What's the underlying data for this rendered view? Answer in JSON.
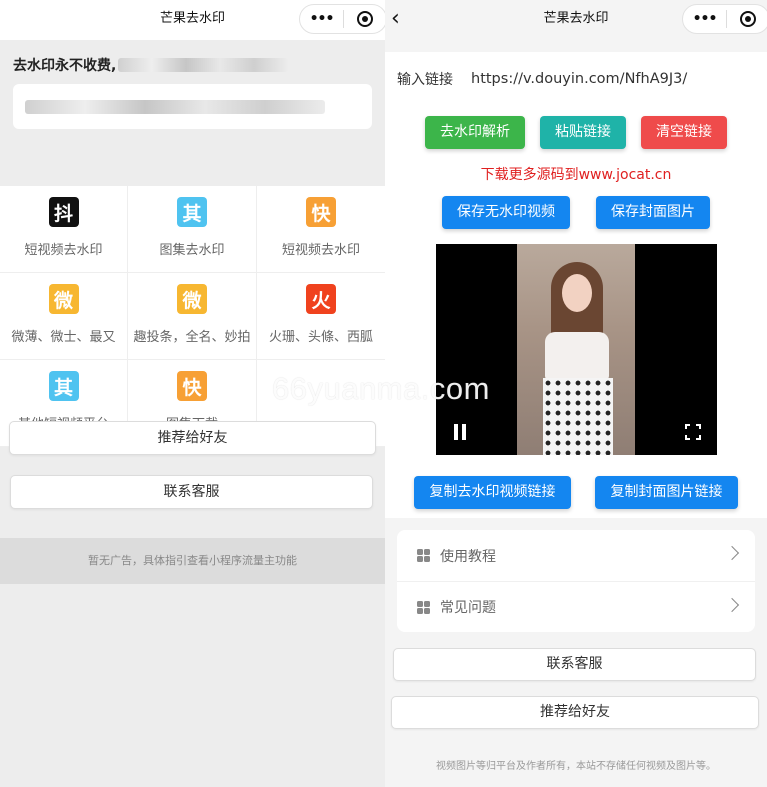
{
  "left": {
    "title": "芒果去水印",
    "menu_dots": "•••",
    "notice_title": "去水印永不收费,",
    "grid": [
      {
        "glyph": "抖",
        "label": "短视频去水印",
        "color": "#111111"
      },
      {
        "glyph": "其",
        "label": "图集去水印",
        "color": "#4fc3f0"
      },
      {
        "glyph": "快",
        "label": "短视频去水印",
        "color": "#f7a035"
      },
      {
        "glyph": "微",
        "label": "微薄、微士、最又",
        "color": "#f7b731"
      },
      {
        "glyph": "微",
        "label": "趣投条，全名、妙拍",
        "color": "#f7b731"
      },
      {
        "glyph": "火",
        "label": "火珊、头條、西胍",
        "color": "#f0421e"
      },
      {
        "glyph": "其",
        "label": "其他短视频平台",
        "color": "#4fc3f0"
      },
      {
        "glyph": "快",
        "label": "图集下载",
        "color": "#f7a035"
      }
    ],
    "share_button": "推荐给好友",
    "contact_button": "联系客服",
    "ad_text": "暂无广告，具体指引查看小程序流量主功能"
  },
  "right": {
    "title": "芒果去水印",
    "menu_dots": "•••",
    "back": "‹",
    "link_label": "输入链接",
    "link_value": "https://v.douyin.com/NfhA9J3/",
    "btn_parse": "去水印解析",
    "btn_paste": "粘贴链接",
    "btn_clear": "清空链接",
    "promo": "下载更多源码到www.jocat.cn",
    "btn_save_video": "保存无水印视频",
    "btn_save_cover": "保存封面图片",
    "btn_copy_video": "复制去水印视频链接",
    "btn_copy_cover": "复制封面图片链接",
    "menu_tutorial": "使用教程",
    "menu_faq": "常见问题",
    "contact_button": "联系客服",
    "share_button": "推荐给好友",
    "footer": "视频图片等归平台及作者所有，本站不存储任何视频及图片等。"
  },
  "watermark": "66yuanma.com",
  "colors": {
    "green": "#3cb54a",
    "teal": "#1fb3a8",
    "red": "#ef4b4b",
    "blue": "#1486f0",
    "promo": "#e02020"
  }
}
